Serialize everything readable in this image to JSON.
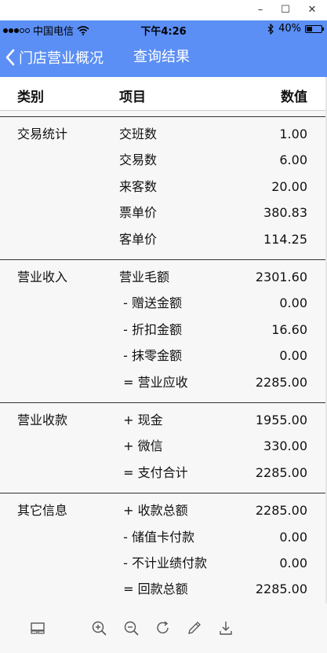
{
  "window": {
    "minimize": "–",
    "maximize": "☐",
    "close": "✕"
  },
  "status_bar": {
    "carrier": "中国电信",
    "time": "下午4:26",
    "battery": "40%",
    "battery_level": 0.4
  },
  "nav": {
    "back_label": "门店营业概况",
    "title": "查询结果"
  },
  "table": {
    "headers": {
      "category": "类别",
      "item": "项目",
      "value": "数值"
    },
    "groups": [
      {
        "category": "交易统计",
        "rows": [
          {
            "item": "交班数",
            "value": "1.00"
          },
          {
            "item": "交易数",
            "value": "6.00"
          },
          {
            "item": "来客数",
            "value": "20.00"
          },
          {
            "item": "票单价",
            "value": "380.83"
          },
          {
            "item": "客单价",
            "value": "114.25"
          }
        ]
      },
      {
        "category": "营业收入",
        "rows": [
          {
            "item": "营业毛额",
            "value": "2301.60"
          },
          {
            "item": " - 赠送金额",
            "value": "0.00"
          },
          {
            "item": " - 折扣金额",
            "value": "16.60"
          },
          {
            "item": " - 抹零金额",
            "value": "0.00"
          },
          {
            "item": " = 营业应收",
            "value": "2285.00"
          }
        ]
      },
      {
        "category": "营业收款",
        "rows": [
          {
            "item": " + 现金",
            "value": "1955.00"
          },
          {
            "item": " + 微信",
            "value": "330.00"
          },
          {
            "item": " = 支付合计",
            "value": "2285.00"
          }
        ]
      },
      {
        "category": "其它信息",
        "rows": [
          {
            "item": " + 收款总额",
            "value": "2285.00"
          },
          {
            "item": " - 储值卡付款",
            "value": "0.00"
          },
          {
            "item": " - 不计业绩付款",
            "value": "0.00"
          },
          {
            "item": " = 回款总额",
            "value": "2285.00"
          }
        ]
      }
    ]
  },
  "toolbar": {
    "icons": [
      "layout-icon",
      "zoom-in-icon",
      "zoom-out-icon",
      "refresh-icon",
      "edit-icon",
      "download-icon"
    ]
  },
  "colors": {
    "accent": "#5b8ff5"
  }
}
